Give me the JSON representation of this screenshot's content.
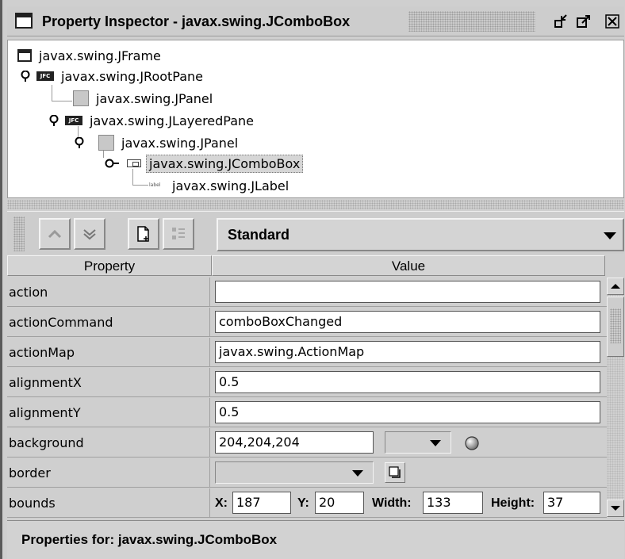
{
  "window": {
    "title": "Property Inspector - javax.swing.JComboBox"
  },
  "tree": {
    "nodes": [
      {
        "label": "javax.swing.JFrame",
        "icon": "frame-icon"
      },
      {
        "label": "javax.swing.JRootPane",
        "icon": "jfc-icon"
      },
      {
        "label": "javax.swing.JPanel",
        "icon": "panel-icon"
      },
      {
        "label": "javax.swing.JLayeredPane",
        "icon": "jfc-icon"
      },
      {
        "label": "javax.swing.JPanel",
        "icon": "panel-icon"
      },
      {
        "label": "javax.swing.JComboBox",
        "icon": "combobox-icon",
        "selected": true
      },
      {
        "label": "javax.swing.JLabel",
        "icon": "label-icon"
      }
    ]
  },
  "toolbar": {
    "view_combo": "Standard"
  },
  "table": {
    "headers": [
      "Property",
      "Value"
    ],
    "rows": [
      {
        "property": "action",
        "value": ""
      },
      {
        "property": "actionCommand",
        "value": "comboBoxChanged"
      },
      {
        "property": "actionMap",
        "value": "javax.swing.ActionMap"
      },
      {
        "property": "alignmentX",
        "value": "0.5"
      },
      {
        "property": "alignmentY",
        "value": "0.5"
      },
      {
        "property": "background",
        "value": "204,204,204"
      },
      {
        "property": "border",
        "value": ""
      },
      {
        "property": "bounds",
        "value": ""
      }
    ],
    "bounds_fields": {
      "x_label": "X:",
      "x": "187",
      "y_label": "Y:",
      "y": "20",
      "width_label": "Width:",
      "width": "133",
      "height_label": "Height:",
      "height": "37"
    }
  },
  "status": {
    "text": "Properties for:  javax.swing.JComboBox"
  },
  "colors": {
    "chrome": "#cfcfcf",
    "selection": "#d6d6d6"
  }
}
